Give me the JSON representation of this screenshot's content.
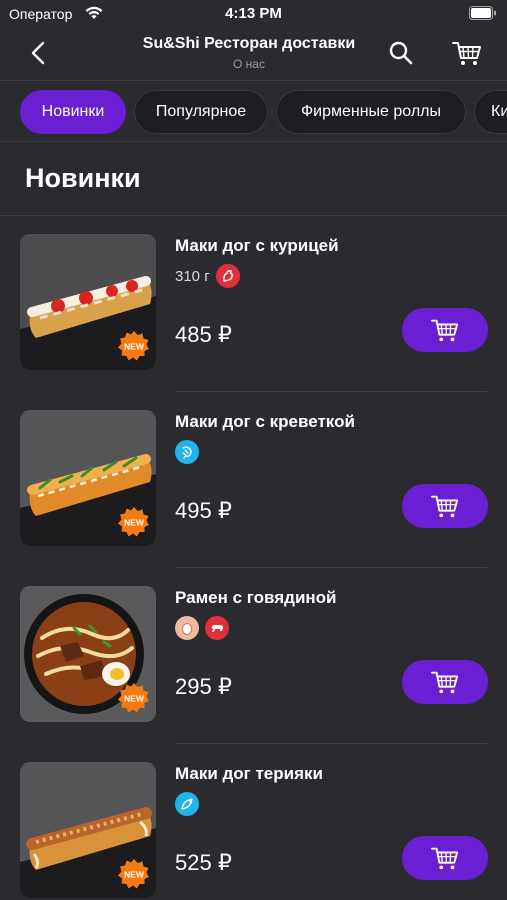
{
  "status": {
    "carrier": "Оператор",
    "time": "4:13 PM"
  },
  "nav": {
    "title": "Su&Shi Ресторан доставки",
    "subtitle": "О нас"
  },
  "tabs": [
    {
      "label": "Новинки",
      "active": true
    },
    {
      "label": "Популярное",
      "active": false
    },
    {
      "label": "Фирменные роллы",
      "active": false
    },
    {
      "label": "Ки",
      "active": false
    }
  ],
  "section": {
    "title": "Новинки"
  },
  "new_badge_text": "NEW",
  "items": [
    {
      "name": "Маки дог с курицей",
      "weight": "310 г",
      "icons": [
        "chicken-icon"
      ],
      "price": "485 ₽"
    },
    {
      "name": "Маки дог с креветкой",
      "weight": "",
      "icons": [
        "shrimp-icon"
      ],
      "price": "495 ₽"
    },
    {
      "name": "Рамен с говядиной",
      "weight": "",
      "icons": [
        "egg-icon",
        "beef-icon"
      ],
      "price": "295 ₽"
    },
    {
      "name": "Маки дог терияки",
      "weight": "",
      "icons": [
        "fish-icon"
      ],
      "price": "525 ₽"
    }
  ],
  "colors": {
    "accent": "#6a1fd2",
    "background": "#2b2b2f",
    "new_badge": "#f47a12"
  }
}
